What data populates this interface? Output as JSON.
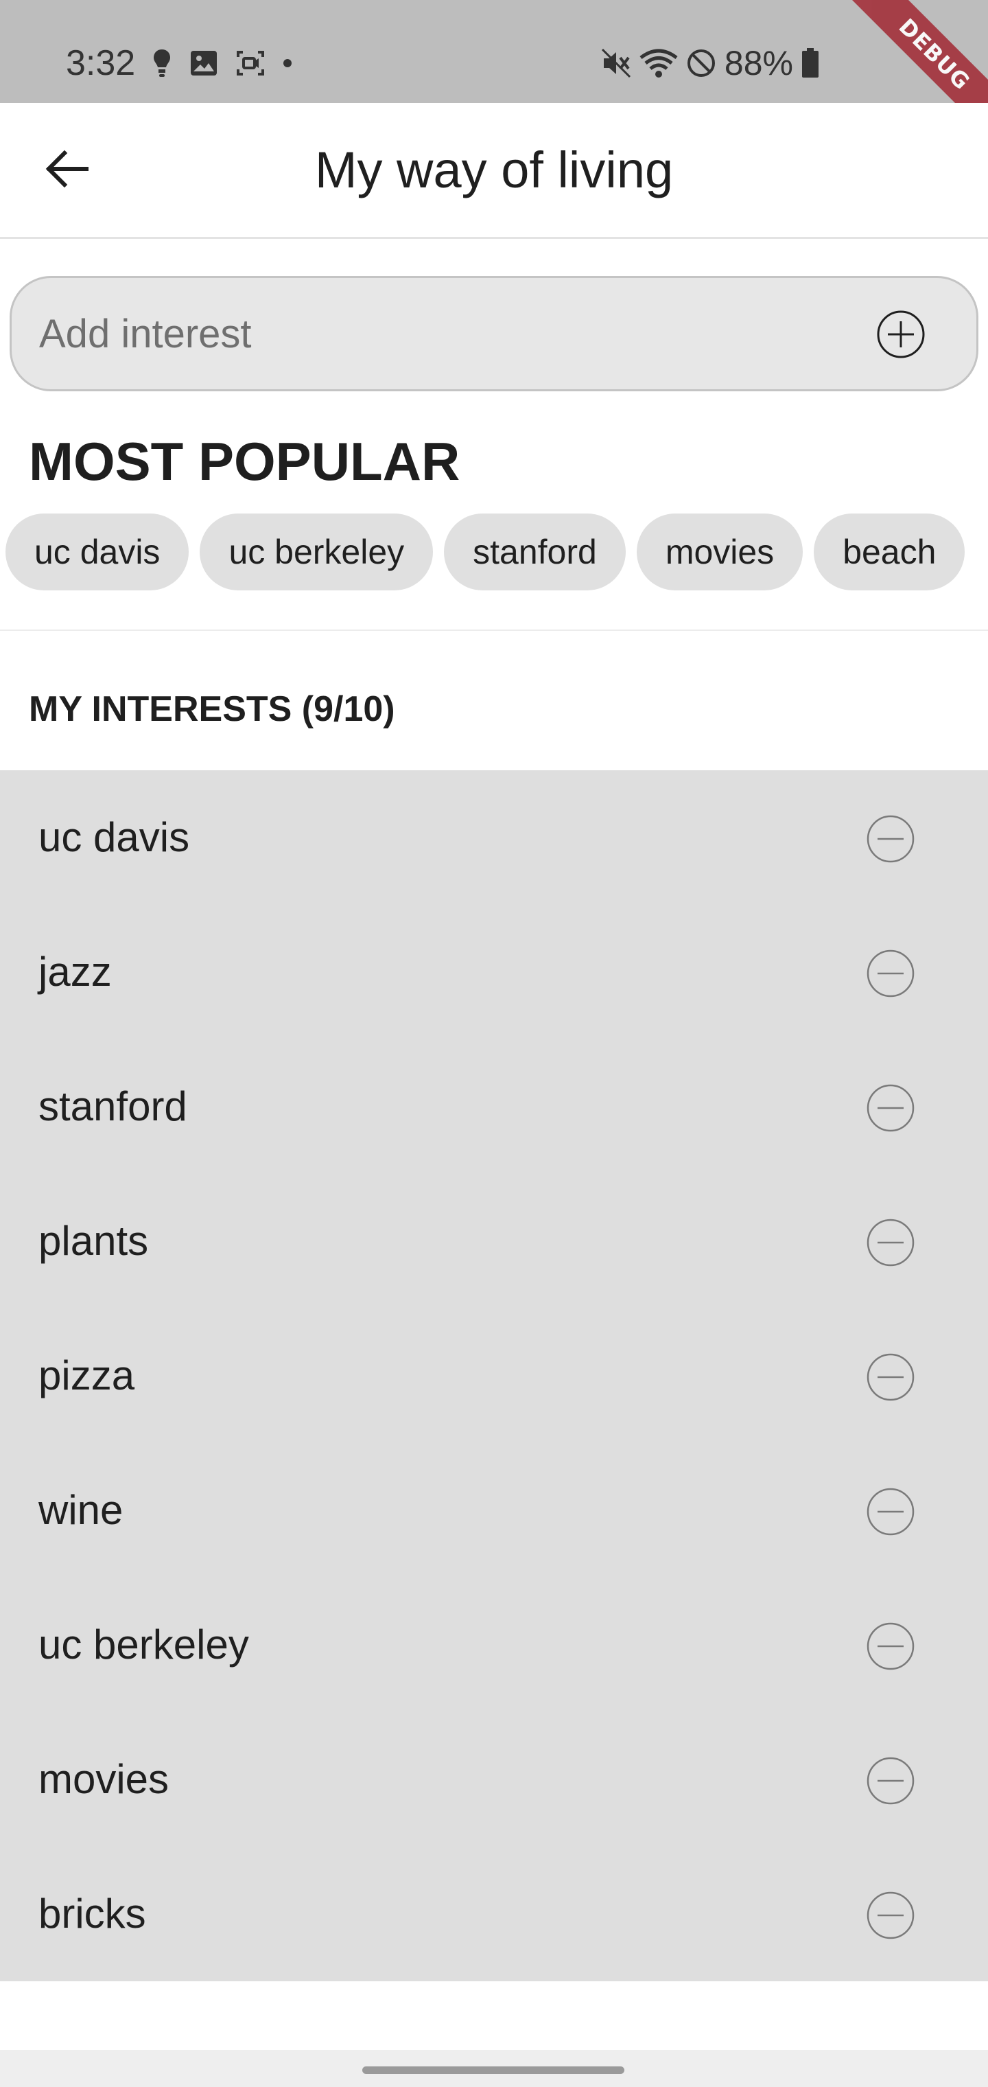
{
  "status_bar": {
    "time": "3:32",
    "left_icons": [
      "lightbulb-icon",
      "image-icon",
      "screen-record-icon",
      "dot-icon"
    ],
    "right_icons": [
      "mute-icon",
      "wifi-icon",
      "do-not-disturb-icon",
      "battery-icon"
    ],
    "battery": "88%"
  },
  "debug_banner": "DEBUG",
  "app_bar": {
    "back_icon": "arrow-left-icon",
    "title": "My way of living"
  },
  "add_field": {
    "value": "",
    "placeholder": "Add interest",
    "button_icon": "add-circle-icon"
  },
  "popular": {
    "title": "MOST POPULAR",
    "chips": [
      "uc davis",
      "uc berkeley",
      "stanford",
      "movies",
      "beach"
    ]
  },
  "interests": {
    "title": "MY INTERESTS (9/10)",
    "remove_icon": "remove-circle-icon",
    "items": [
      "uc davis",
      "jazz",
      "stanford",
      "plants",
      "pizza",
      "wine",
      "uc berkeley",
      "movies",
      "bricks"
    ]
  },
  "colors": {
    "status_bar_bg": "#bdbdbd",
    "list_bg": "#dedede",
    "chip_bg": "#e0e0e0",
    "debug_ribbon": "#a3313b"
  }
}
